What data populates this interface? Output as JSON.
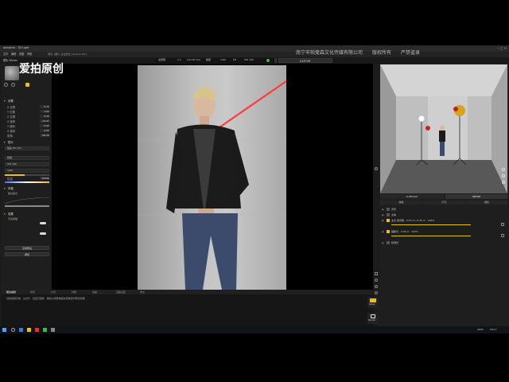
{
  "app": {
    "window_title": "autoshot - 3D Light",
    "menu": [
      "文件",
      "编辑",
      "视图",
      "帮助"
    ],
    "project_path": "项目: [图片_女性皮衣_studio3.dsh]"
  },
  "tabs": {
    "setup": "SETUP",
    "view": "VIEW",
    "export": "EXPORT"
  },
  "toolbar": {
    "items": [
      "全屏幕",
      "1:1",
      "24×36 mm",
      "焦距",
      "1/60",
      "f/8",
      "ISO 100"
    ]
  },
  "watermark": {
    "left": "爱拍原创",
    "right": "南宁市帕斐森文化传媒有限公司　　版权所有　　严禁盗录"
  },
  "left_panel": {
    "header": "镜头 50mm",
    "sections": {
      "camera": "设置",
      "camera_fields": [
        {
          "label": "X 位置",
          "value": "0.72"
        },
        {
          "label": "Y 位置",
          "value": "1.62"
        },
        {
          "label": "Z 位置",
          "value": "2.35"
        },
        {
          "label": "X 旋转",
          "value": "-12.47"
        },
        {
          "label": "Y 旋转",
          "value": "0.00"
        },
        {
          "label": "Z 旋转",
          "value": "0.00"
        },
        {
          "label": "视角",
          "value": "-58.29"
        }
      ],
      "lens": "镜头",
      "lens_value": "镜头 50 mm",
      "dd_1": "自动",
      "dd_2": "ISO 100",
      "dd_3": "1/60",
      "field_value": "5000K",
      "style": "风格",
      "style_sub": "黑白模式",
      "effects": "效果",
      "effects_sub": "景深模糊",
      "btn_1": "应用预设",
      "btn_2": "重置"
    }
  },
  "right_panel": {
    "tabs": [
      "SUMMARY",
      "SETUP"
    ],
    "subtabs": [
      "模板",
      "灯光",
      "相机"
    ],
    "layers": [
      {
        "label": "背景"
      },
      {
        "label": "主体"
      },
      {
        "label": "主光 柔光箱 · 0.25 m / 0.35 m · 100%"
      },
      {
        "label": "辅助光 · 0.50 m · 100%"
      },
      {
        "label": "轮廓光"
      }
    ]
  },
  "bottom_panel": {
    "tabs": [
      "属性编辑",
      "场景",
      "灯光",
      "材质",
      "动画",
      "渲染设置",
      "导出"
    ],
    "status_line": "当前选择对象：主光灯 · 位置已更新 · 拖动以调整角度并查看实时预览效果"
  },
  "side_buttons": {
    "setup": "Setup",
    "render": "Render"
  },
  "taskbar": {
    "time": "16:17",
    "date": "2023"
  },
  "colors": {
    "accent": "#e8c21c",
    "laser": "#ff3b3b",
    "panel": "#1e1e1e"
  }
}
